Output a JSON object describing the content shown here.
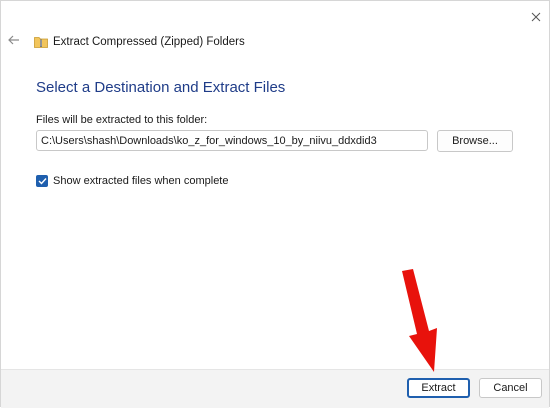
{
  "window": {
    "title": "Extract Compressed (Zipped) Folders",
    "close_icon": "close-icon",
    "back_icon": "back-arrow-icon",
    "title_icon": "zip-folder-icon"
  },
  "main": {
    "heading": "Select a Destination and Extract Files",
    "path_label": "Files will be extracted to this folder:",
    "path_value": "C:\\Users\\shash\\Downloads\\ko_z_for_windows_10_by_niivu_ddxdid3",
    "browse_label": "Browse...",
    "show_files_label": "Show extracted files when complete",
    "show_files_checked": true
  },
  "footer": {
    "extract_label": "Extract",
    "cancel_label": "Cancel"
  },
  "annotation": {
    "arrow_icon": "red-arrow-annotation",
    "arrow_color": "#e8120c"
  },
  "colors": {
    "accent": "#1f5fae",
    "heading": "#1f3c88",
    "footer_bg": "#f3f3f3"
  }
}
